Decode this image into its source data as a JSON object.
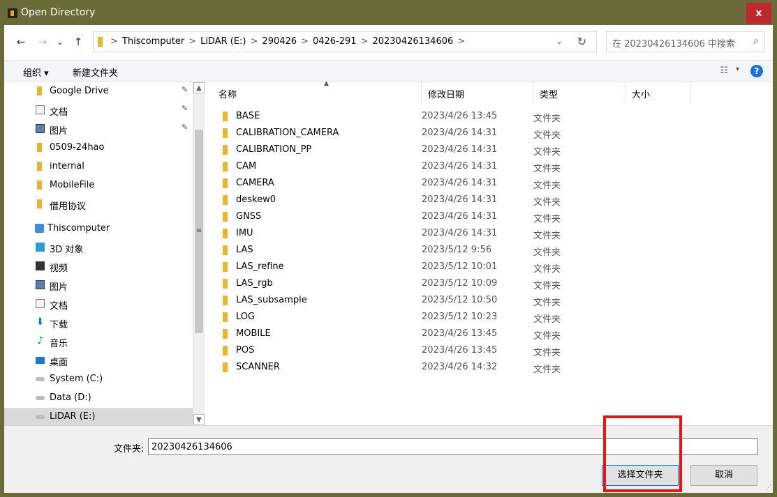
{
  "window": {
    "title": "Open Directory",
    "close_label": "x"
  },
  "nav": {
    "back": "←",
    "forward": "→",
    "recent": "⌄",
    "up": "↑"
  },
  "address": {
    "crumbs": [
      "Thiscomputer",
      "LiDAR (E:)",
      "290426",
      "0426-291",
      "20230426134606"
    ],
    "separator": ">",
    "dropdown": "⌄",
    "refresh": "↻"
  },
  "search": {
    "placeholder": "在 20230426134606 中搜索",
    "icon": "⌕"
  },
  "toolbar": {
    "organize": "组织 ▾",
    "new_folder": "新建文件夹",
    "view_icon": "☷",
    "view_arrow": "▾",
    "help": "?"
  },
  "sidebar": {
    "items": [
      {
        "label": "Google Drive",
        "icon": "folder",
        "pinned": true
      },
      {
        "label": "文档",
        "icon": "doc",
        "pinned": true
      },
      {
        "label": "图片",
        "icon": "pic",
        "pinned": true
      },
      {
        "label": "0509-24hao",
        "icon": "folder",
        "pinned": false
      },
      {
        "label": "internal",
        "icon": "folder",
        "pinned": false
      },
      {
        "label": "MobileFile",
        "icon": "folder",
        "pinned": false
      },
      {
        "label": "借用协议",
        "icon": "folder",
        "pinned": false
      },
      {
        "label": "Thiscomputer",
        "icon": "pc",
        "pinned": false
      },
      {
        "label": "3D 对象",
        "icon": "cube",
        "pinned": false
      },
      {
        "label": "视频",
        "icon": "video",
        "pinned": false
      },
      {
        "label": "图片",
        "icon": "pic",
        "pinned": false
      },
      {
        "label": "文档",
        "icon": "doc",
        "pinned": false
      },
      {
        "label": "下载",
        "icon": "dl",
        "pinned": false
      },
      {
        "label": "音乐",
        "icon": "music",
        "pinned": false
      },
      {
        "label": "桌面",
        "icon": "desktop",
        "pinned": false
      },
      {
        "label": "System (C:)",
        "icon": "drive",
        "pinned": false
      },
      {
        "label": "Data (D:)",
        "icon": "drive",
        "pinned": false
      },
      {
        "label": "LiDAR (E:)",
        "icon": "drive",
        "pinned": false,
        "selected": true
      }
    ]
  },
  "columns": {
    "name": "名称",
    "modified": "修改日期",
    "type": "类型",
    "size": "大小"
  },
  "files": [
    {
      "name": "BASE",
      "date": "2023/4/26 13:45",
      "type": "文件夹"
    },
    {
      "name": "CALIBRATION_CAMERA",
      "date": "2023/4/26 14:31",
      "type": "文件夹"
    },
    {
      "name": "CALIBRATION_PP",
      "date": "2023/4/26 14:31",
      "type": "文件夹"
    },
    {
      "name": "CAM",
      "date": "2023/4/26 14:31",
      "type": "文件夹"
    },
    {
      "name": "CAMERA",
      "date": "2023/4/26 14:31",
      "type": "文件夹"
    },
    {
      "name": "deskew0",
      "date": "2023/4/26 14:31",
      "type": "文件夹"
    },
    {
      "name": "GNSS",
      "date": "2023/4/26 14:31",
      "type": "文件夹"
    },
    {
      "name": "IMU",
      "date": "2023/4/26 14:31",
      "type": "文件夹"
    },
    {
      "name": "LAS",
      "date": "2023/5/12 9:56",
      "type": "文件夹"
    },
    {
      "name": "LAS_refine",
      "date": "2023/5/12 10:01",
      "type": "文件夹"
    },
    {
      "name": "LAS_rgb",
      "date": "2023/5/12 10:09",
      "type": "文件夹"
    },
    {
      "name": "LAS_subsample",
      "date": "2023/5/12 10:50",
      "type": "文件夹"
    },
    {
      "name": "LOG",
      "date": "2023/5/12 10:23",
      "type": "文件夹"
    },
    {
      "name": "MOBILE",
      "date": "2023/4/26 13:45",
      "type": "文件夹"
    },
    {
      "name": "POS",
      "date": "2023/4/26 13:45",
      "type": "文件夹"
    },
    {
      "name": "SCANNER",
      "date": "2023/4/26 14:32",
      "type": "文件夹"
    }
  ],
  "footer": {
    "folder_label": "文件夹:",
    "folder_value": "20230426134606",
    "select_button": "选择文件夹",
    "cancel_button": "取消"
  },
  "colors": {
    "titlebar": "#6b6b3a",
    "highlight": "#e8151a",
    "folder": "#e8b531"
  }
}
